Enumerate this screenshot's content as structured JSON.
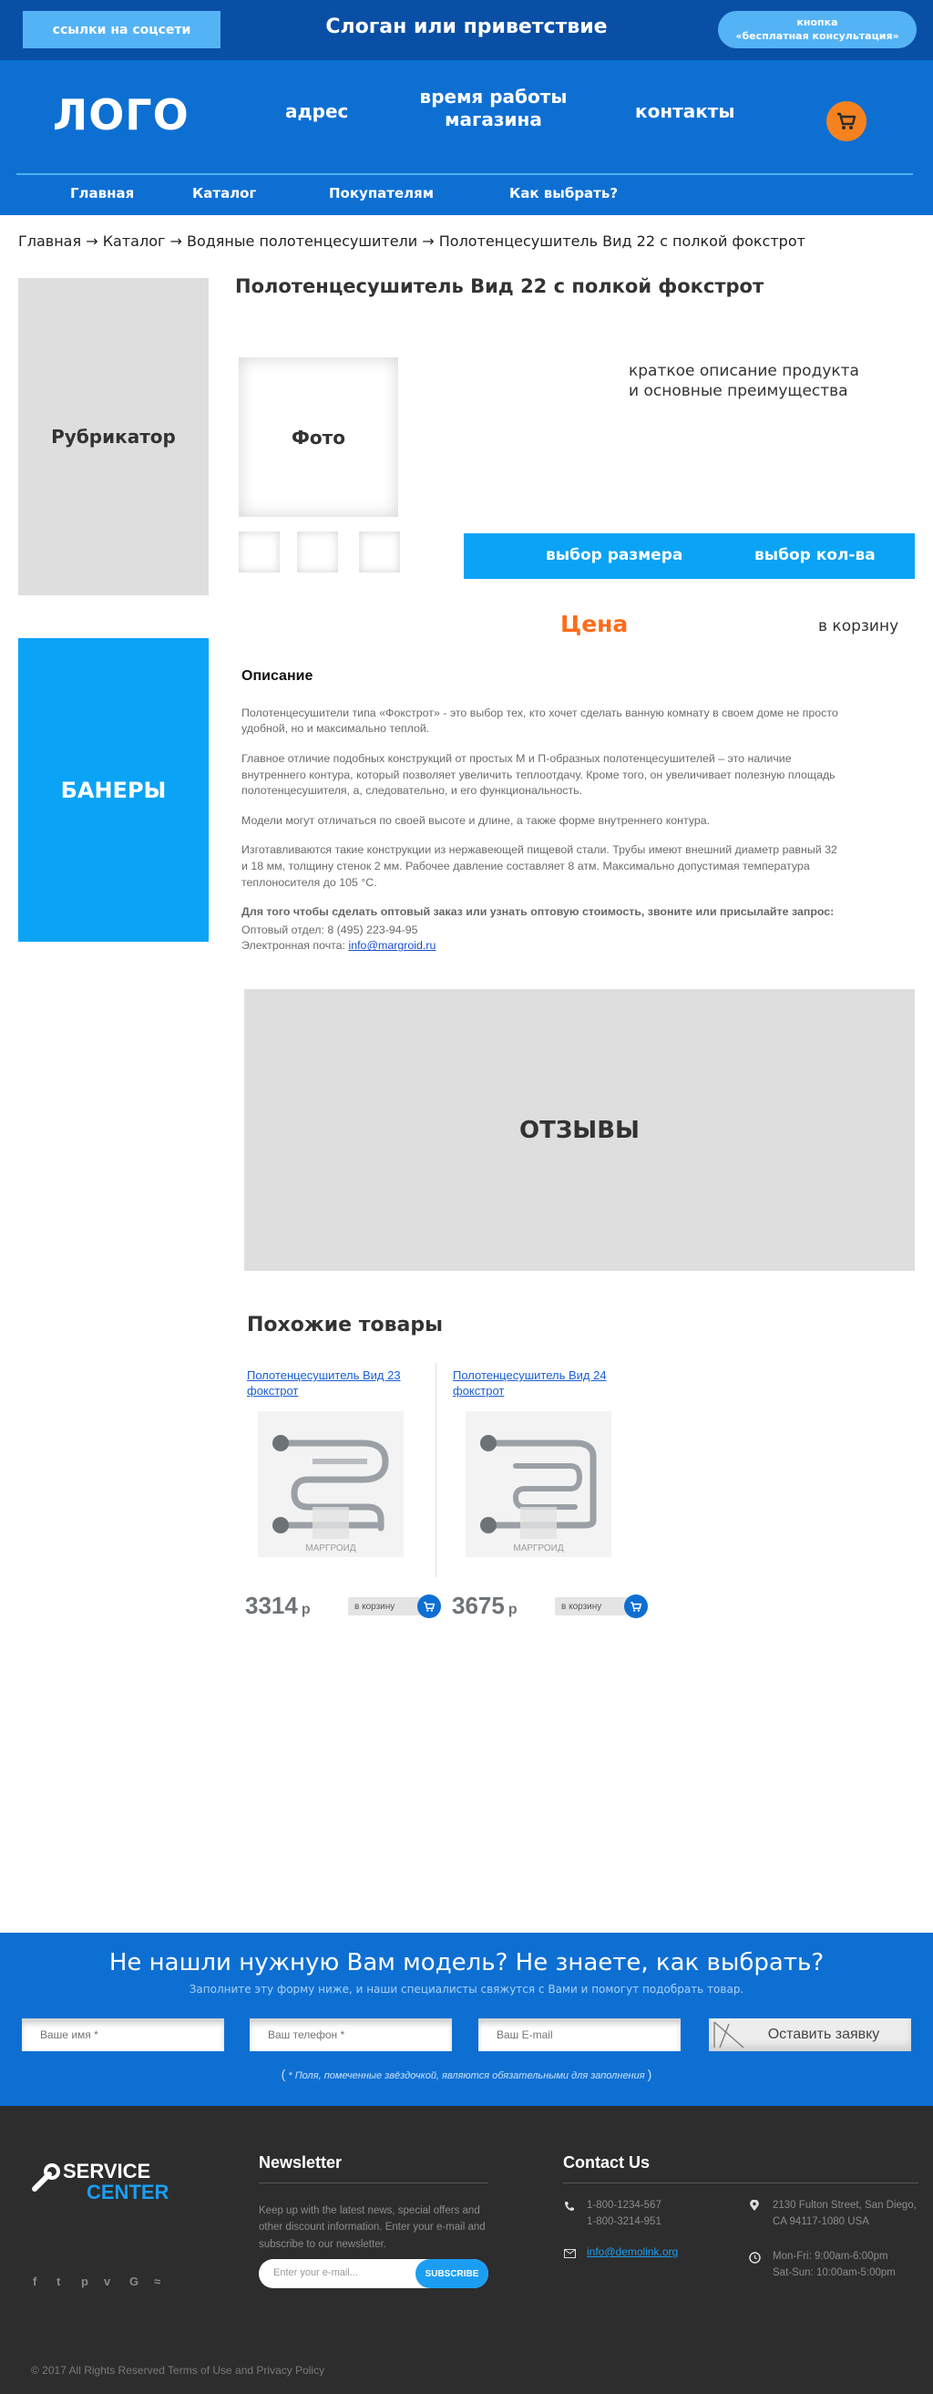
{
  "topbar": {
    "social_button": "ссылки на соцсети",
    "slogan": "Слоган или приветствие",
    "consult_line1": "кнопка",
    "consult_line2": "«бесплатная консультация»"
  },
  "header": {
    "logo": "ЛОГО",
    "address": "адрес",
    "hours_line1": "время работы",
    "hours_line2": "магазина",
    "contacts": "контакты",
    "menu": [
      "Главная",
      "Каталог",
      "Покупателям",
      "Как выбрать?"
    ]
  },
  "breadcrumb": "Главная → Каталог → Водяные полотенцесушители → Полотенцесушитель Вид 22 с полкой фокстрот",
  "sidebar": {
    "rubricator": "Рубрикатор",
    "banners": "БАНЕРЫ"
  },
  "product": {
    "title": "Полотенцесушитель Вид 22 с полкой фокстрот",
    "photo_label": "Фото",
    "short_desc_line1": "краткое описание продукта",
    "short_desc_line2": "и основные преимущества",
    "size_select": "выбор размера",
    "qty_select": "выбор кол-ва",
    "price": "Цена",
    "add_to_cart": "в корзину"
  },
  "description": {
    "heading": "Описание",
    "p1": "Полотенцесушители типа «Фокстрот» - это выбор тех, кто хочет сделать ванную комнату в своем доме не просто удобной, но и максимально теплой.",
    "p2": "Главное отличие подобных конструкций от простых М и П-образных полотенцесушителей – это наличие внутреннего контура, который позволяет увеличить теплоотдачу. Кроме того, он увеличивает полезную площадь полотенцесушителя, а, следовательно, и его функциональность.",
    "p3": "Модели могут отличаться по своей высоте и длине, а также форме внутреннего контура.",
    "p4": "Изготавливаются такие конструкции из нержавеющей пищевой стали. Трубы имеют внешний диаметр равный 32 и 18 мм, толщину стенок 2 мм. Рабочее давление составляет 8 атм. Максимально допустимая температура теплоносителя до 105 °С.",
    "wholesale_note": "Для того чтобы сделать оптовый заказ или узнать оптовую стоимость, звоните или присылайте запрос:",
    "phone_line": "Оптовый отдел: 8 (495) 223-94-95",
    "email_prefix": "Электронная почта: ",
    "email": "info@margroid.ru"
  },
  "reviews": {
    "label": "ОТЗЫВЫ"
  },
  "similar": {
    "title": "Похожие товары",
    "items": [
      {
        "name": "Полотенцесушитель Вид 23 фокстрот",
        "price": "3314",
        "currency": "р",
        "cart": "в корзину",
        "brand": "МАРГРОИД"
      },
      {
        "name": "Полотенцесушитель Вид 24 фокстрот",
        "price": "3675",
        "currency": "р",
        "cart": "в корзину",
        "brand": "МАРГРОИД"
      }
    ]
  },
  "request_form": {
    "title": "Не нашли нужную Вам модель? Не знаете, как выбрать?",
    "subtitle": "Заполните эту форму ниже, и наши специалисты свяжутся с Вами и помогут подобрать товар.",
    "name_placeholder": "Ваше имя *",
    "phone_placeholder": "Ваш телефон *",
    "email_placeholder": "Ваш E-mail",
    "submit": "Оставить заявку",
    "note": "* Поля, помеченные звёздочкой, являются обязательными для заполнения"
  },
  "footer": {
    "brand_line1": "SERVICE",
    "brand_line2": "CENTER",
    "social_icons": [
      "facebook-icon",
      "twitter-icon",
      "pinterest-icon",
      "vimeo-icon",
      "google-icon",
      "rss-icon"
    ],
    "newsletter_title": "Newsletter",
    "newsletter_text": "Keep up with the latest news, special offers and other discount information. Enter your e-mail and subscribe to our newsletter.",
    "email_placeholder": "Enter your e-mail...",
    "subscribe": "SUBSCRIBE",
    "contact_title": "Contact Us",
    "phone1": "1-800-1234-567",
    "phone2": "1-800-3214-951",
    "contact_email": "info@demolink.org",
    "address_line1": "2130 Fulton Street, San Diego,",
    "address_line2": "CA 94117-1080 USA",
    "hours_line1": "Mon-Fri: 9:00am-6:00pm",
    "hours_line2": "Sat-Sun: 10:00am-5:00pm",
    "copyright": "© 2017 All Rights Reserved Terms of Use and Privacy Policy"
  },
  "colors": {
    "topbar": "#0a4fa6",
    "header": "#0e6fd3",
    "accent_light": "#0aa3f5",
    "price": "#ff6b1a",
    "cart_icon": "#f6821f",
    "footer": "#2d2d2d"
  }
}
